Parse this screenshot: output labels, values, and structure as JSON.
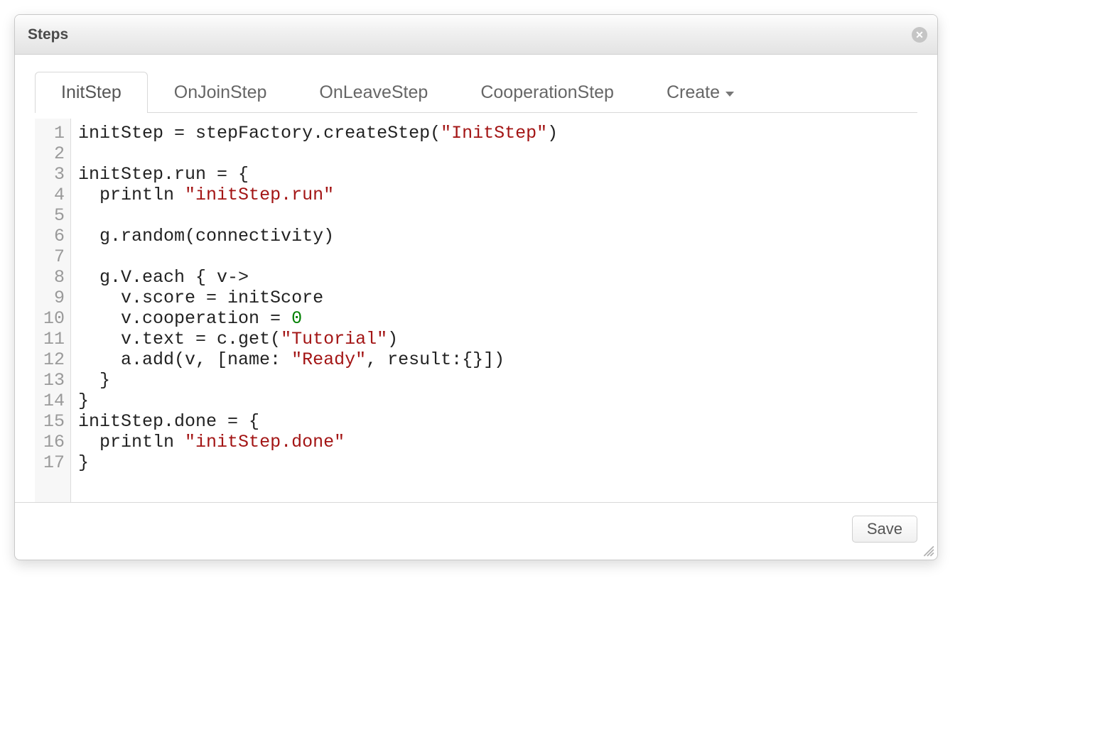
{
  "dialog": {
    "title": "Steps"
  },
  "tabs": {
    "items": [
      {
        "label": "InitStep",
        "active": true
      },
      {
        "label": "OnJoinStep",
        "active": false
      },
      {
        "label": "OnLeaveStep",
        "active": false
      },
      {
        "label": "CooperationStep",
        "active": false
      }
    ],
    "create_label": "Create"
  },
  "editor": {
    "line_count": 17,
    "lines": [
      {
        "n": 1,
        "tokens": [
          {
            "t": "initStep = stepFactory.createStep("
          },
          {
            "t": "\"InitStep\"",
            "c": "tok-str"
          },
          {
            "t": ")"
          }
        ]
      },
      {
        "n": 2,
        "tokens": [
          {
            "t": ""
          }
        ]
      },
      {
        "n": 3,
        "tokens": [
          {
            "t": "initStep.run = {"
          }
        ]
      },
      {
        "n": 4,
        "tokens": [
          {
            "t": "  println "
          },
          {
            "t": "\"initStep.run\"",
            "c": "tok-str"
          }
        ]
      },
      {
        "n": 5,
        "tokens": [
          {
            "t": ""
          }
        ]
      },
      {
        "n": 6,
        "tokens": [
          {
            "t": "  g.random(connectivity)"
          }
        ]
      },
      {
        "n": 7,
        "tokens": [
          {
            "t": ""
          }
        ]
      },
      {
        "n": 8,
        "tokens": [
          {
            "t": "  g.V.each { v->"
          }
        ]
      },
      {
        "n": 9,
        "tokens": [
          {
            "t": "    v.score = initScore"
          }
        ]
      },
      {
        "n": 10,
        "tokens": [
          {
            "t": "    v.cooperation = "
          },
          {
            "t": "0",
            "c": "tok-num"
          }
        ]
      },
      {
        "n": 11,
        "tokens": [
          {
            "t": "    v.text = c.get("
          },
          {
            "t": "\"Tutorial\"",
            "c": "tok-str"
          },
          {
            "t": ")"
          }
        ]
      },
      {
        "n": 12,
        "tokens": [
          {
            "t": "    a.add(v, [name: "
          },
          {
            "t": "\"Ready\"",
            "c": "tok-str"
          },
          {
            "t": ", result:{}])"
          }
        ]
      },
      {
        "n": 13,
        "tokens": [
          {
            "t": "  }"
          }
        ]
      },
      {
        "n": 14,
        "tokens": [
          {
            "t": "}"
          }
        ]
      },
      {
        "n": 15,
        "tokens": [
          {
            "t": "initStep.done = {"
          }
        ]
      },
      {
        "n": 16,
        "tokens": [
          {
            "t": "  println "
          },
          {
            "t": "\"initStep.done\"",
            "c": "tok-str"
          }
        ]
      },
      {
        "n": 17,
        "tokens": [
          {
            "t": "}"
          }
        ]
      }
    ]
  },
  "footer": {
    "save_label": "Save"
  }
}
